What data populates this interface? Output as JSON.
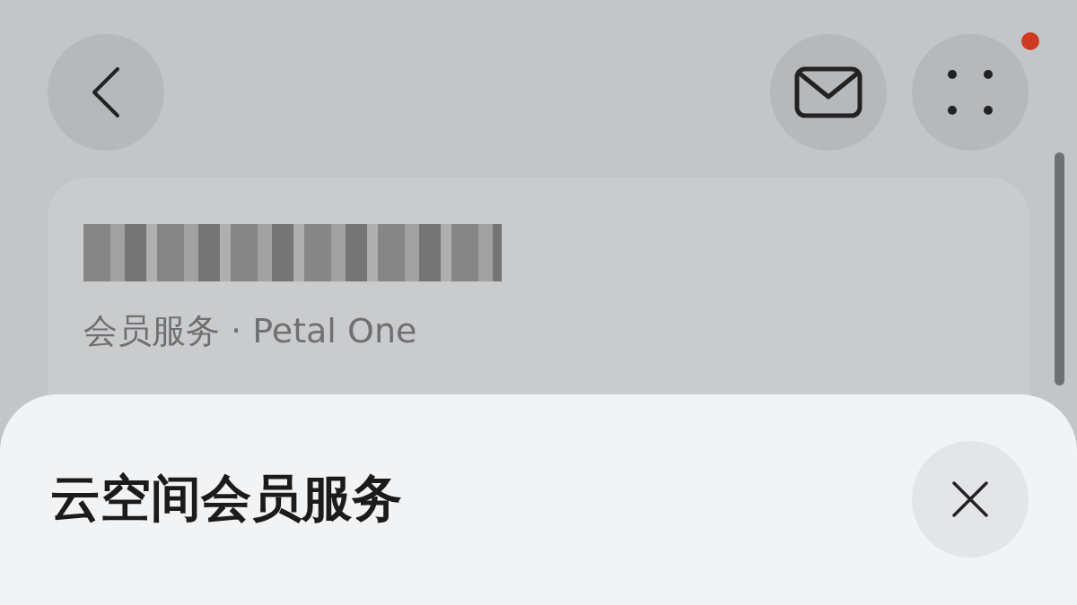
{
  "top_bar": {
    "menu_notification": true
  },
  "card": {
    "subtitle": "会员服务 · Petal One"
  },
  "sheet": {
    "title": "云空间会员服务"
  }
}
